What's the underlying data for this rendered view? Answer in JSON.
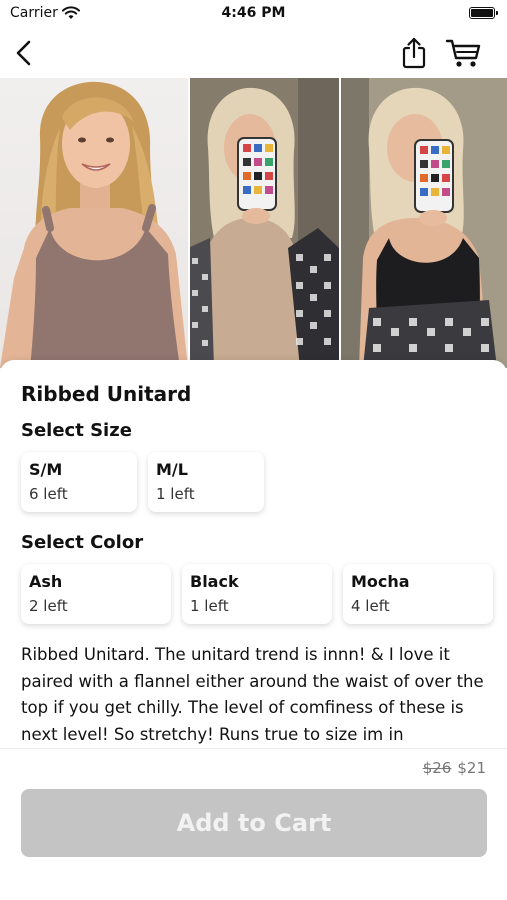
{
  "status_bar": {
    "carrier": "Carrier",
    "time": "4:46 PM"
  },
  "nav": {
    "back_icon": "chevron-left-icon",
    "share_icon": "share-icon",
    "cart_icon": "cart-icon"
  },
  "gallery": {
    "photo_count": 3
  },
  "product": {
    "title": "Ribbed Unitard",
    "size_heading": "Select Size",
    "sizes": [
      {
        "name": "S/M",
        "stock": "6 left"
      },
      {
        "name": "M/L",
        "stock": "1 left"
      }
    ],
    "color_heading": "Select Color",
    "colors": [
      {
        "name": "Ash",
        "stock": "2 left"
      },
      {
        "name": "Black",
        "stock": "1 left"
      },
      {
        "name": "Mocha",
        "stock": "4 left"
      }
    ],
    "description": "Ribbed Unitard. The unitard trend is innn! & I love it paired with a flannel either around the waist of over the top if you get chilly. The level of comfiness of these is next level! So stretchy! Runs true to size im in"
  },
  "footer": {
    "old_price": "$26",
    "price": "$21",
    "add_to_cart_label": "Add to Cart"
  },
  "colors": {
    "button_disabled": "#c4c4c4",
    "button_text": "#f2f2f2",
    "text": "#111111"
  }
}
